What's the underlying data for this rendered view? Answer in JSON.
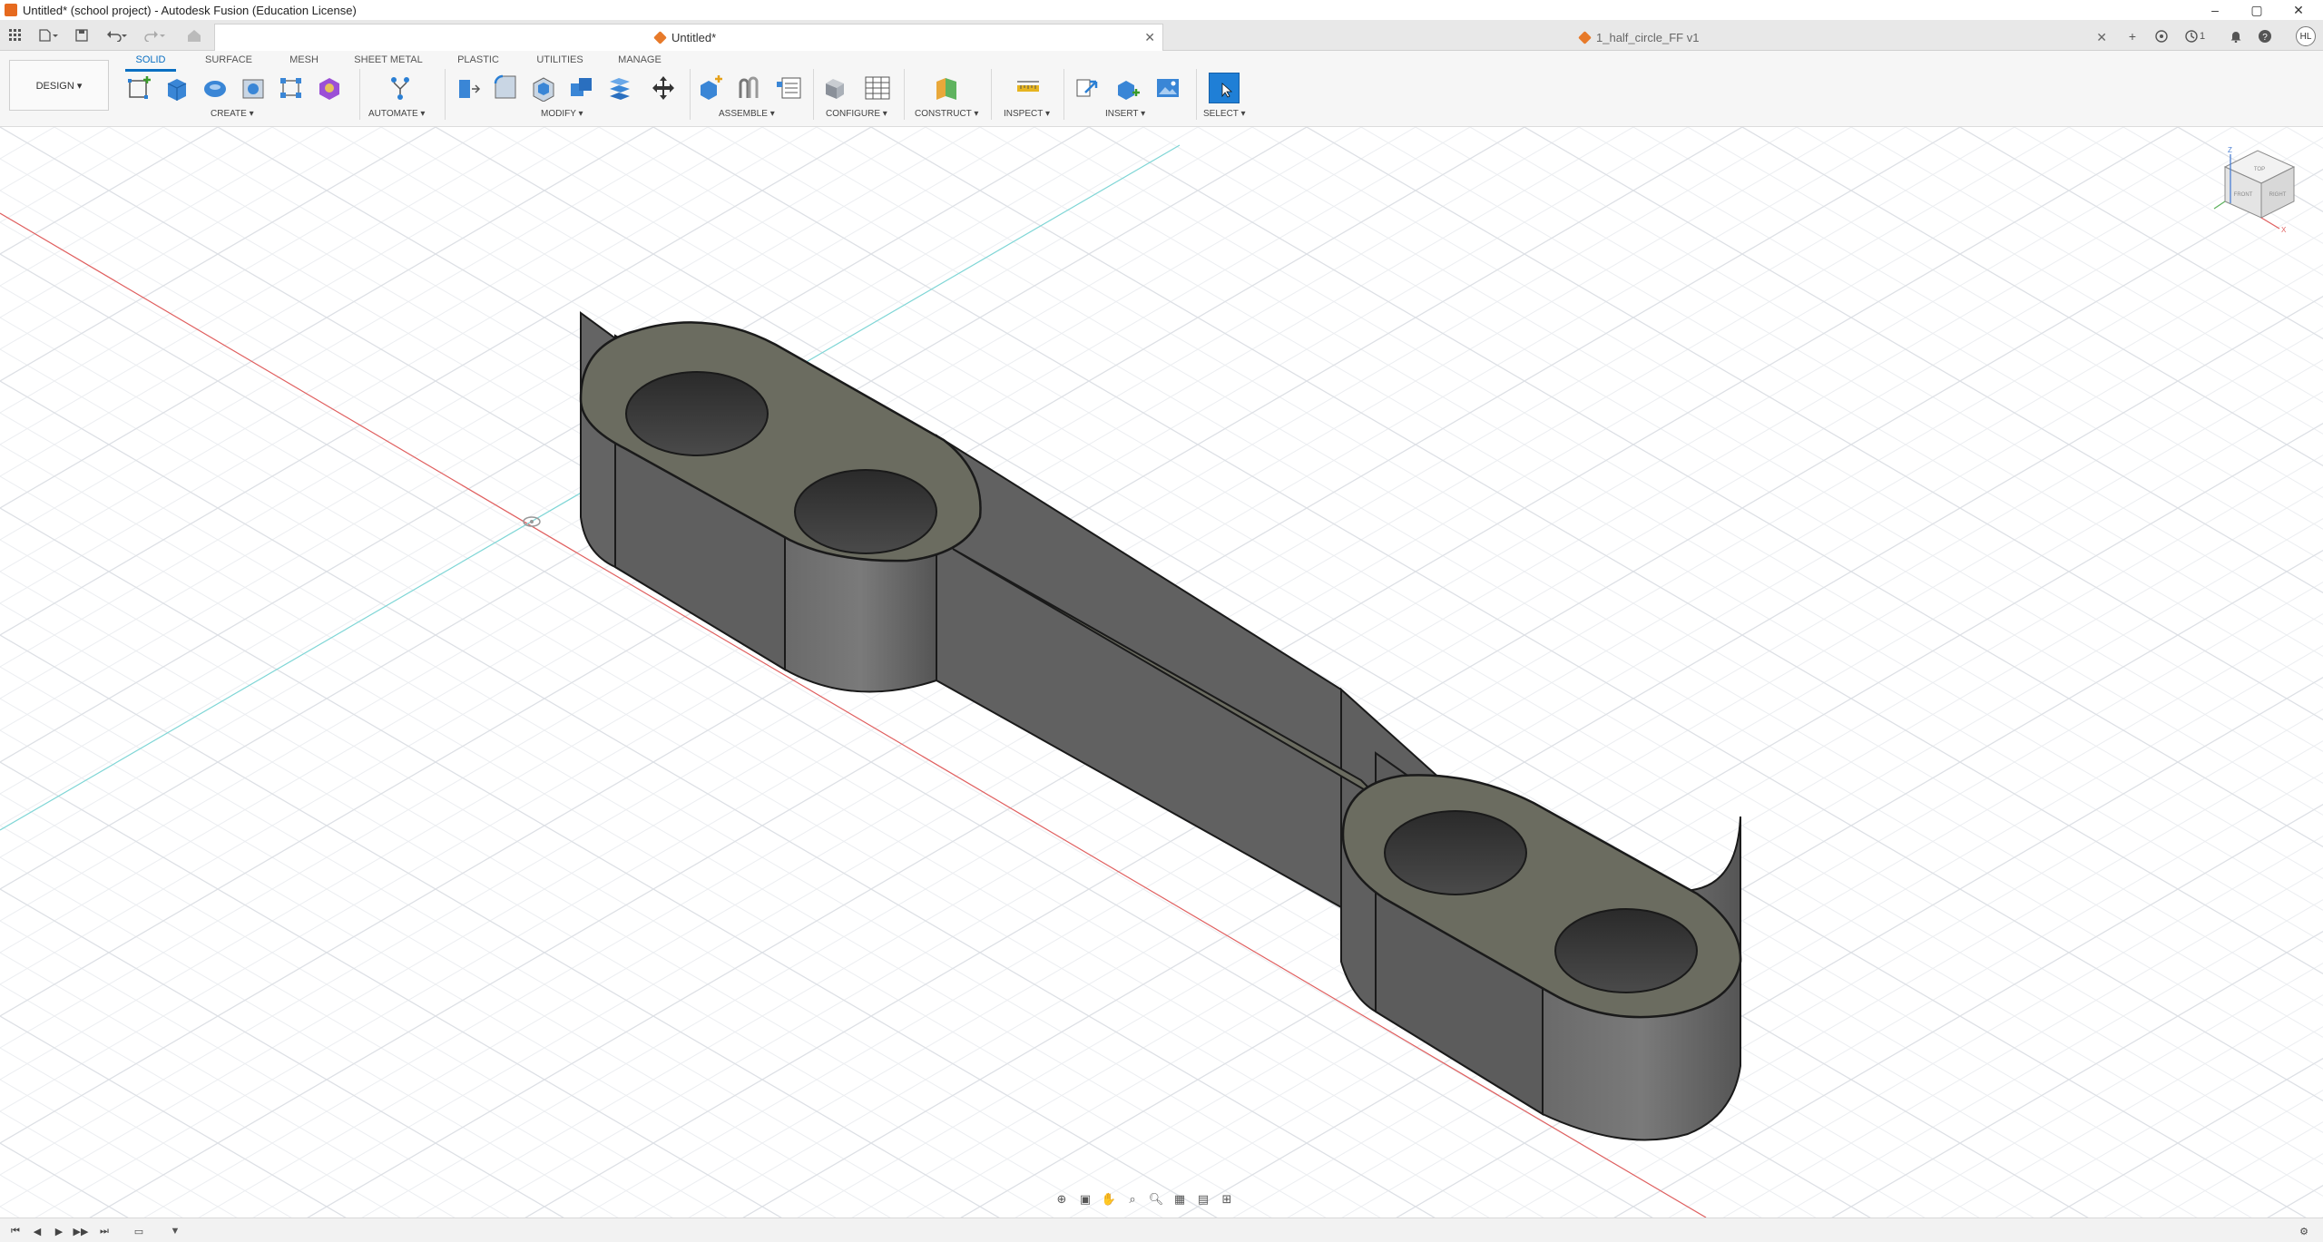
{
  "window": {
    "title": "Untitled* (school project) - Autodesk Fusion (Education License)",
    "controls": [
      "–",
      "▢",
      "✕"
    ]
  },
  "tabs": [
    {
      "label": "Untitled*",
      "active": true
    },
    {
      "label": "1_half_circle_FF v1",
      "active": false
    }
  ],
  "header_right": {
    "job_count": "1",
    "avatar_initials": "HL"
  },
  "toolbar": {
    "workspace_button": "DESIGN ▾",
    "workspace_tabs": [
      "SOLID",
      "SURFACE",
      "MESH",
      "SHEET METAL",
      "PLASTIC",
      "UTILITIES",
      "MANAGE"
    ],
    "groups": [
      "CREATE ▾",
      "AUTOMATE ▾",
      "MODIFY ▾",
      "ASSEMBLE ▾",
      "CONFIGURE ▾",
      "CONSTRUCT ▾",
      "INSPECT ▾",
      "INSERT ▾",
      "SELECT ▾"
    ]
  },
  "viewcube": {
    "faces": [
      "TOP",
      "FRONT",
      "RIGHT"
    ],
    "axes": [
      "Z",
      "X",
      "Y"
    ]
  },
  "colors": {
    "accent": "#0a6fc2",
    "model_top": "#6b6c60",
    "model_side": "#5e5e5e",
    "grid": "#e4e6ea",
    "x_axis": "#e06060",
    "y_axis": "#7fd6d6"
  }
}
